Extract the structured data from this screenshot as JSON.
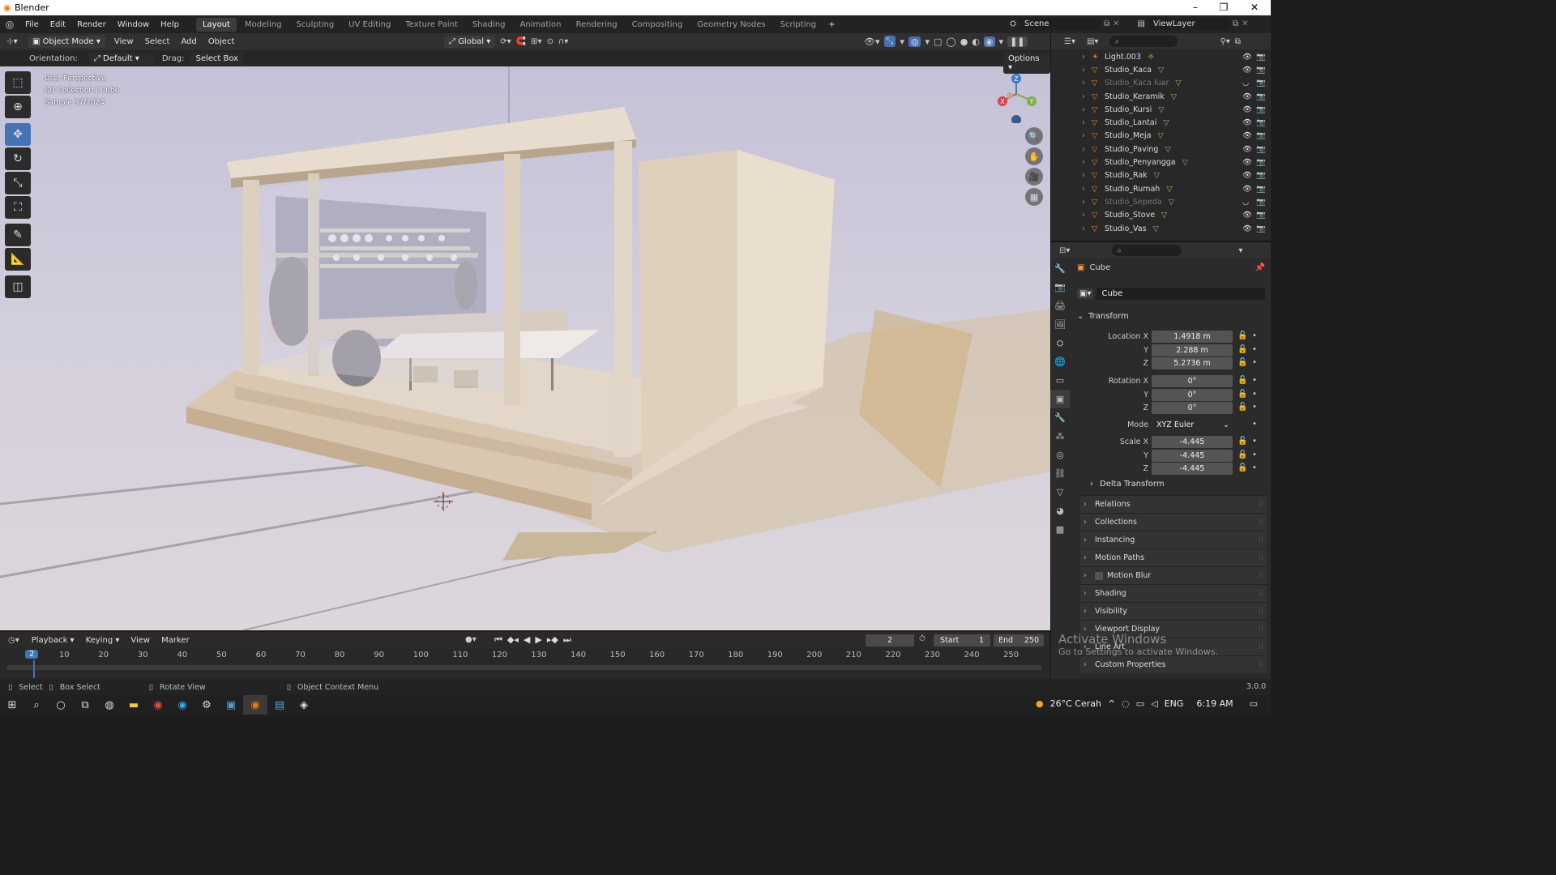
{
  "window": {
    "title": "Blender",
    "min": "–",
    "restore": "❐",
    "close": "✕"
  },
  "menus": [
    "File",
    "Edit",
    "Render",
    "Window",
    "Help"
  ],
  "workspaces": [
    {
      "label": "Layout",
      "active": true
    },
    {
      "label": "Modeling"
    },
    {
      "label": "Sculpting"
    },
    {
      "label": "UV Editing"
    },
    {
      "label": "Texture Paint"
    },
    {
      "label": "Shading"
    },
    {
      "label": "Animation"
    },
    {
      "label": "Rendering"
    },
    {
      "label": "Compositing"
    },
    {
      "label": "Geometry Nodes"
    },
    {
      "label": "Scripting"
    }
  ],
  "add_workspace": "+",
  "scene": "Scene",
  "view_layer": "ViewLayer",
  "viewport_header": {
    "mode": "Object Mode",
    "view": "View",
    "select": "Select",
    "add": "Add",
    "object": "Object",
    "transform": "Global",
    "options": "Options"
  },
  "tool_options": {
    "orientation_label": "Orientation:",
    "orientation_value": "Default",
    "drag_label": "Drag:",
    "drag_value": "Select Box"
  },
  "viewport_info": {
    "line1": "User Perspective",
    "line2": "(2) Collection | Cube",
    "line3": "Sample 37/1024"
  },
  "gizmo": {
    "x": "X",
    "y": "Y",
    "z": "Z"
  },
  "outliner": [
    {
      "name": "Light.003",
      "kind": "light"
    },
    {
      "name": "Studio_Kaca",
      "kind": "mesh"
    },
    {
      "name": "Studio_Kaca luar",
      "kind": "mesh",
      "hidden": true
    },
    {
      "name": "Studio_Keramik",
      "kind": "mesh"
    },
    {
      "name": "Studio_Kursi",
      "kind": "mesh"
    },
    {
      "name": "Studio_Lantai",
      "kind": "mesh"
    },
    {
      "name": "Studio_Meja",
      "kind": "mesh"
    },
    {
      "name": "Studio_Paving",
      "kind": "mesh"
    },
    {
      "name": "Studio_Penyangga",
      "kind": "mesh"
    },
    {
      "name": "Studio_Rak",
      "kind": "mesh"
    },
    {
      "name": "Studio_Rumah",
      "kind": "mesh"
    },
    {
      "name": "Studio_Sepeda",
      "kind": "mesh",
      "hidden": true
    },
    {
      "name": "Studio_Stove",
      "kind": "mesh"
    },
    {
      "name": "Studio_Vas",
      "kind": "mesh"
    }
  ],
  "properties": {
    "object_name": "Cube",
    "data_name": "Cube",
    "transform_label": "Transform",
    "location": {
      "label": "Location X",
      "x": "1.4918 m",
      "y": "2.288 m",
      "z": "5.2736 m"
    },
    "rotation": {
      "label": "Rotation X",
      "x": "0°",
      "y": "0°",
      "z": "0°"
    },
    "axis_y": "Y",
    "axis_z": "Z",
    "mode_label": "Mode",
    "mode_value": "XYZ Euler",
    "scale": {
      "label": "Scale X",
      "x": "-4.445",
      "y": "-4.445",
      "z": "-4.445"
    },
    "delta_transform": "Delta Transform",
    "panels": [
      "Relations",
      "Collections",
      "Instancing",
      "Motion Paths",
      "Motion Blur",
      "Shading",
      "Visibility",
      "Viewport Display",
      "Line Art",
      "Custom Properties"
    ]
  },
  "timeline": {
    "playback": "Playback",
    "keying": "Keying",
    "view": "View",
    "marker": "Marker",
    "current_frame": "2",
    "start_label": "Start",
    "start": "1",
    "end_label": "End",
    "end": "250",
    "ticks": [
      "10",
      "20",
      "30",
      "40",
      "50",
      "60",
      "70",
      "80",
      "90",
      "100",
      "110",
      "120",
      "130",
      "140",
      "150",
      "160",
      "170",
      "180",
      "190",
      "200",
      "210",
      "220",
      "230",
      "240",
      "250"
    ],
    "playhead": "2"
  },
  "statusbar": {
    "select": "Select",
    "box_select": "Box Select",
    "rotate": "Rotate View",
    "context": "Object Context Menu",
    "version": "3.0.0"
  },
  "watermark": {
    "line1": "Activate Windows",
    "line2": "Go to Settings to activate Windows."
  },
  "taskbar": {
    "weather": "26°C  Cerah",
    "lang": "ENG",
    "time": "6:19 AM"
  },
  "colors": {
    "accent": "#4772b3",
    "mesh": "#e0853a",
    "eye": "#dddddd"
  }
}
